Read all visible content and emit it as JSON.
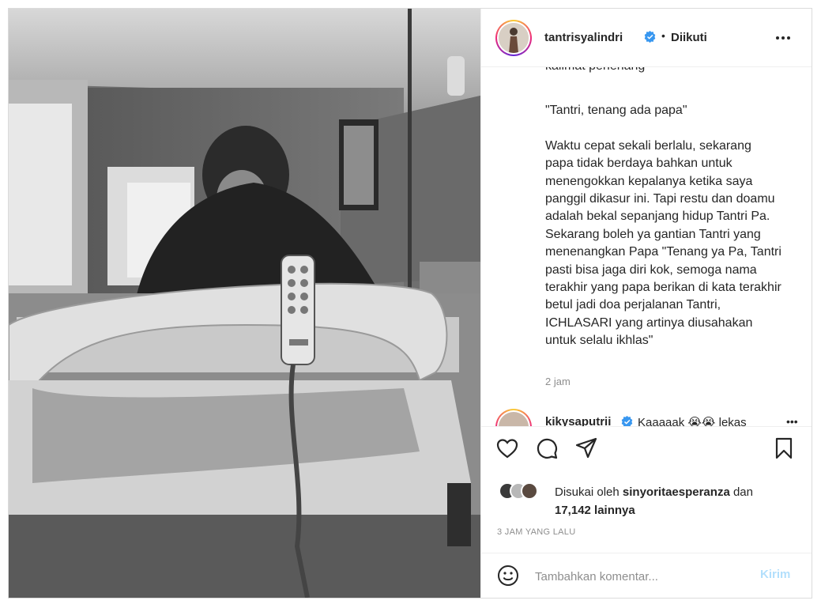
{
  "post": {
    "username": "tantrisyalindri",
    "follow_status": "Diikuti",
    "separator": "•",
    "more_label": "•••"
  },
  "caption": {
    "cut_line": "kalimat penenang",
    "text": "\"Tantri, tenang ada papa\"\n\nWaktu cepat sekali berlalu, sekarang papa tidak berdaya bahkan untuk menengokkan kepalanya ketika saya panggil dikasur ini. Tapi restu dan doamu adalah bekal sepanjang hidup Tantri Pa. Sekarang boleh ya gantian Tantri yang menenangkan Papa \"Tenang ya Pa, Tantri pasti bisa jaga diri kok, semoga nama terakhir yang papa berikan di kata terakhir betul jadi doa perjalanan Tantri, ICHLASARI yang artinya diusahakan untuk selalu ikhlas\"",
    "time": "2 jam"
  },
  "comment2": {
    "username": "kikysaputrii",
    "text": "Kaaaaak 😭😭 lekas",
    "dots": "•••"
  },
  "likes": {
    "prefix": "Disukai oleh",
    "user": "sinyoritaesperanza",
    "joiner": "dan",
    "count": "17,142 lainnya"
  },
  "post_time": "3 JAM YANG LALU",
  "add_comment": {
    "placeholder": "Tambahkan komentar...",
    "send_label": "Kirim"
  },
  "colors": {
    "verified": "#3897f0",
    "send_disabled": "#b2dffc",
    "muted": "#8e8e8e"
  }
}
